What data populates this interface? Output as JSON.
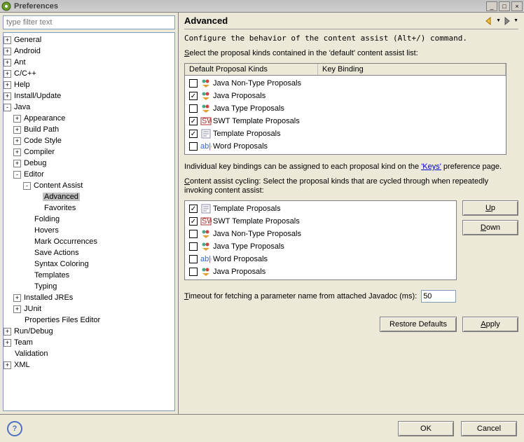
{
  "window": {
    "title": "Preferences"
  },
  "filter": {
    "placeholder": "type filter text"
  },
  "tree": [
    {
      "label": "General",
      "depth": 0,
      "exp": "+"
    },
    {
      "label": "Android",
      "depth": 0,
      "exp": "+"
    },
    {
      "label": "Ant",
      "depth": 0,
      "exp": "+"
    },
    {
      "label": "C/C++",
      "depth": 0,
      "exp": "+"
    },
    {
      "label": "Help",
      "depth": 0,
      "exp": "+"
    },
    {
      "label": "Install/Update",
      "depth": 0,
      "exp": "+"
    },
    {
      "label": "Java",
      "depth": 0,
      "exp": "-"
    },
    {
      "label": "Appearance",
      "depth": 1,
      "exp": "+"
    },
    {
      "label": "Build Path",
      "depth": 1,
      "exp": "+"
    },
    {
      "label": "Code Style",
      "depth": 1,
      "exp": "+"
    },
    {
      "label": "Compiler",
      "depth": 1,
      "exp": "+"
    },
    {
      "label": "Debug",
      "depth": 1,
      "exp": "+"
    },
    {
      "label": "Editor",
      "depth": 1,
      "exp": "-"
    },
    {
      "label": "Content Assist",
      "depth": 2,
      "exp": "-"
    },
    {
      "label": "Advanced",
      "depth": 3,
      "exp": "",
      "sel": true
    },
    {
      "label": "Favorites",
      "depth": 3,
      "exp": ""
    },
    {
      "label": "Folding",
      "depth": 2,
      "exp": ""
    },
    {
      "label": "Hovers",
      "depth": 2,
      "exp": ""
    },
    {
      "label": "Mark Occurrences",
      "depth": 2,
      "exp": ""
    },
    {
      "label": "Save Actions",
      "depth": 2,
      "exp": ""
    },
    {
      "label": "Syntax Coloring",
      "depth": 2,
      "exp": ""
    },
    {
      "label": "Templates",
      "depth": 2,
      "exp": ""
    },
    {
      "label": "Typing",
      "depth": 2,
      "exp": ""
    },
    {
      "label": "Installed JREs",
      "depth": 1,
      "exp": "+"
    },
    {
      "label": "JUnit",
      "depth": 1,
      "exp": "+"
    },
    {
      "label": "Properties Files Editor",
      "depth": 1,
      "exp": ""
    },
    {
      "label": "Run/Debug",
      "depth": 0,
      "exp": "+"
    },
    {
      "label": "Team",
      "depth": 0,
      "exp": "+"
    },
    {
      "label": "Validation",
      "depth": 0,
      "exp": ""
    },
    {
      "label": "XML",
      "depth": 0,
      "exp": "+"
    }
  ],
  "page": {
    "title": "Advanced",
    "desc": "Configure the behavior of the content assist (Alt+/) command.",
    "default_list_label": "Select the proposal kinds contained in the 'default' content assist list:",
    "table1": {
      "col1": "Default Proposal Kinds",
      "col2": "Key Binding",
      "rows": [
        {
          "checked": false,
          "icon": "java",
          "label": "Java Non-Type Proposals"
        },
        {
          "checked": true,
          "icon": "java",
          "label": "Java Proposals"
        },
        {
          "checked": false,
          "icon": "java",
          "label": "Java Type Proposals"
        },
        {
          "checked": true,
          "icon": "swt",
          "label": "SWT Template Proposals"
        },
        {
          "checked": true,
          "icon": "tmpl",
          "label": "Template Proposals"
        },
        {
          "checked": false,
          "icon": "word",
          "label": "Word Proposals"
        }
      ]
    },
    "keybinding_text_pre": "Individual key bindings can be assigned to each proposal kind on the ",
    "keybinding_link": "'Keys'",
    "keybinding_text_post": " preference page.",
    "cycling_label": "Content assist cycling: Select the proposal kinds that are cycled through when repeatedly invoking content assist:",
    "table2": {
      "rows": [
        {
          "checked": true,
          "icon": "tmpl",
          "label": "Template Proposals"
        },
        {
          "checked": true,
          "icon": "swt",
          "label": "SWT Template Proposals"
        },
        {
          "checked": false,
          "icon": "java",
          "label": "Java Non-Type Proposals"
        },
        {
          "checked": false,
          "icon": "java",
          "label": "Java Type Proposals"
        },
        {
          "checked": false,
          "icon": "word",
          "label": "Word Proposals"
        },
        {
          "checked": false,
          "icon": "java",
          "label": "Java Proposals"
        }
      ]
    },
    "up": "Up",
    "down": "Down",
    "timeout_label": "Timeout for fetching a parameter name from attached Javadoc (ms):",
    "timeout_value": "50",
    "restore": "Restore Defaults",
    "apply": "Apply"
  },
  "footer": {
    "ok": "OK",
    "cancel": "Cancel"
  }
}
